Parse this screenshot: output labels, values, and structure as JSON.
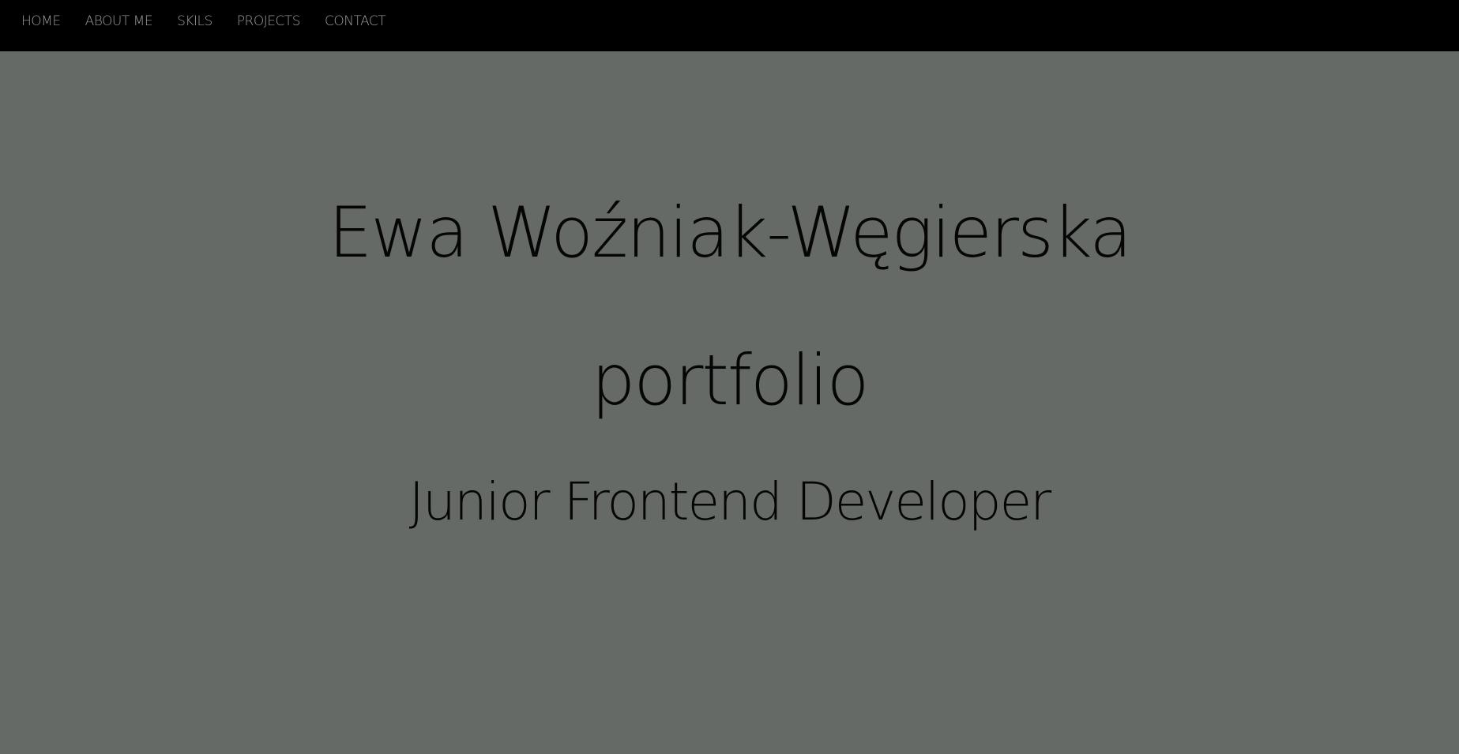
{
  "nav": {
    "items": [
      {
        "label": "HOME"
      },
      {
        "label": "ABOUT ME"
      },
      {
        "label": "SKILS"
      },
      {
        "label": "PROJECTS"
      },
      {
        "label": "CONTACT"
      }
    ]
  },
  "hero": {
    "name": "Ewa Woźniak-Węgierska",
    "portfolio": "portfolio",
    "role": "Junior Frontend Developer"
  },
  "colors": {
    "nav_background": "#000000",
    "nav_text": "#9a9a9a",
    "hero_background": "#656a66",
    "hero_text": "#050505"
  }
}
